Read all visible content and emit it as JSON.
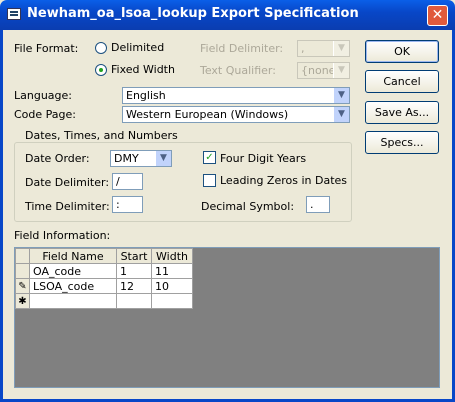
{
  "window": {
    "title": "Newham_oa_lsoa_lookup Export Specification",
    "close": "✕"
  },
  "file_format": {
    "label": "File Format:",
    "delimited_label": "Delimited",
    "fixed_width_label": "Fixed Width",
    "selected": "Fixed Width"
  },
  "field_delimiter": {
    "label": "Field Delimiter:",
    "value": ","
  },
  "text_qualifier": {
    "label": "Text Qualifier:",
    "value": "{none}"
  },
  "language": {
    "label": "Language:",
    "value": "English"
  },
  "code_page": {
    "label": "Code Page:",
    "value": "Western European (Windows)"
  },
  "dates_group": {
    "legend": "Dates, Times, and Numbers",
    "date_order_label": "Date Order:",
    "date_order_value": "DMY",
    "date_delimiter_label": "Date Delimiter:",
    "date_delimiter_value": "/",
    "time_delimiter_label": "Time Delimiter:",
    "time_delimiter_value": ":",
    "four_digit_years_label": "Four Digit Years",
    "four_digit_years_checked": true,
    "leading_zeros_label": "Leading Zeros in Dates",
    "leading_zeros_checked": false,
    "decimal_symbol_label": "Decimal Symbol:",
    "decimal_symbol_value": "."
  },
  "buttons": {
    "ok": "OK",
    "cancel": "Cancel",
    "save_as": "Save As...",
    "specs": "Specs..."
  },
  "field_info": {
    "label": "Field Information:",
    "columns": [
      "Field Name",
      "Start",
      "Width"
    ],
    "rows": [
      {
        "selector": "",
        "name": "OA_code",
        "start": "1",
        "width": "11"
      },
      {
        "selector": "✎",
        "name": "LSOA_code",
        "start": "12",
        "width": "10"
      },
      {
        "selector": "✱",
        "name": "",
        "start": "",
        "width": ""
      }
    ]
  }
}
